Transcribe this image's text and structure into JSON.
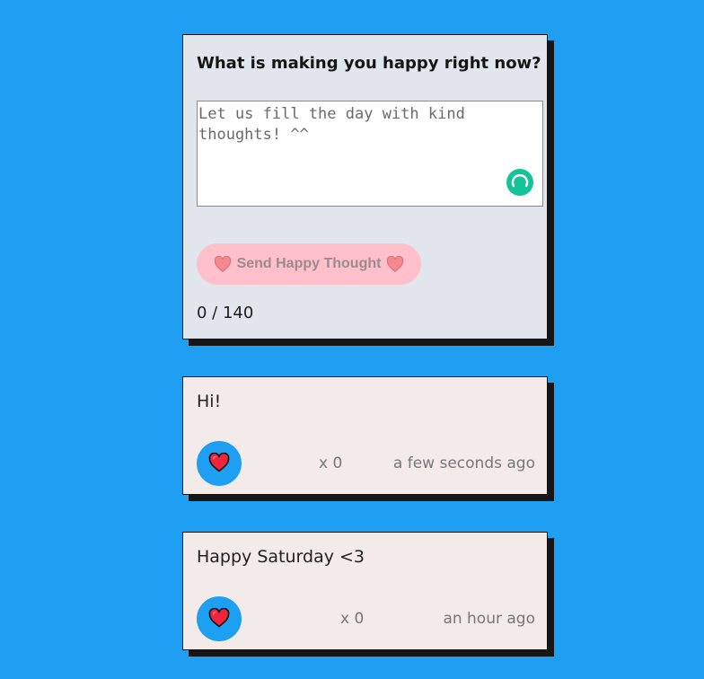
{
  "form": {
    "title": "What is making you happy right now?",
    "textarea_value": "",
    "textarea_placeholder": "Let us fill the day with kind thoughts! ^^",
    "send_button_label": "Send Happy Thought",
    "send_button_icon": "heart-icon",
    "char_count": "0 / 140"
  },
  "thoughts": [
    {
      "message": "Hi!",
      "like_icon": "heart-icon",
      "likes": "x 0",
      "time": "a few seconds ago"
    },
    {
      "message": "Happy Saturday <3",
      "like_icon": "heart-icon",
      "likes": "x 0",
      "time": "an hour ago"
    }
  ],
  "colors": {
    "background": "#1e9ff1",
    "form_card": "#e0e6ec",
    "thought_card": "#f3ebea",
    "send_button": "#ffc0cb",
    "like_button": "#1e9ff1",
    "heart": "#f0243a",
    "grammar_badge": "#15c39a"
  }
}
